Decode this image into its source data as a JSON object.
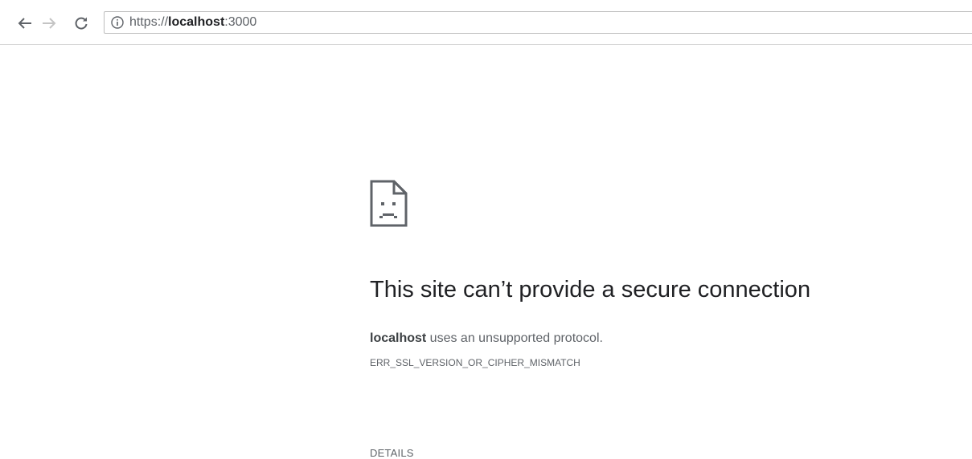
{
  "browser": {
    "url_scheme": "https://",
    "url_host": "localhost",
    "url_port": ":3000",
    "icons": {
      "back": "back-arrow-icon",
      "forward": "forward-arrow-icon",
      "reload": "reload-icon",
      "site_info": "info-icon"
    }
  },
  "error_page": {
    "icon": "sad-page-icon",
    "headline": "This site can’t provide a secure connection",
    "summary_host": "localhost",
    "summary_rest": " uses an unsupported protocol.",
    "error_code": "ERR_SSL_VERSION_OR_CIPHER_MISMATCH",
    "details_label": "DETAILS"
  },
  "colors": {
    "text_primary": "#202124",
    "text_secondary": "#5f6368",
    "icon": "#5f6368",
    "icon_disabled": "#c4c4c4"
  }
}
